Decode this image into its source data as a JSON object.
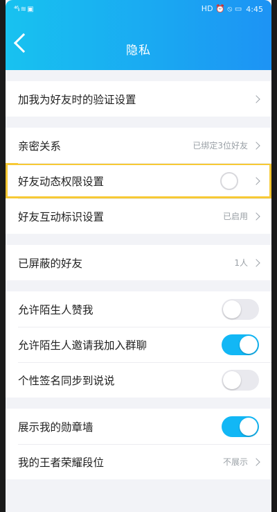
{
  "status_bar": {
    "left": "⁴⁶ᵢₗ ≋ ▣",
    "right_icons": "HD ⏰ ⦸ ▭",
    "time": "4:45"
  },
  "header": {
    "title": "隐私"
  },
  "sections": [
    {
      "rows": [
        {
          "label": "加我为好友时的验证设置",
          "value": ""
        }
      ]
    },
    {
      "rows": [
        {
          "label": "亲密关系",
          "value": "已绑定3位好友"
        },
        {
          "label": "好友动态权限设置",
          "value": ""
        },
        {
          "label": "好友互动标识设置",
          "value": "已启用"
        }
      ]
    },
    {
      "rows": [
        {
          "label": "已屏蔽的好友",
          "value": "1人"
        }
      ]
    },
    {
      "rows": [
        {
          "label": "允许陌生人赞我",
          "toggle": false
        },
        {
          "label": "允许陌生人邀请我加入群聊",
          "toggle": true
        },
        {
          "label": "个性签名同步到说说",
          "toggle": false
        }
      ]
    },
    {
      "rows": [
        {
          "label": "展示我的勋章墙",
          "toggle": true
        },
        {
          "label": "我的王者荣耀段位",
          "value": "不展示"
        }
      ]
    }
  ],
  "colors": {
    "header_gradient_start": "#18c2f0",
    "header_gradient_end": "#1d93f4",
    "toggle_on": "#12b7f5",
    "highlight": "#f7c934"
  }
}
